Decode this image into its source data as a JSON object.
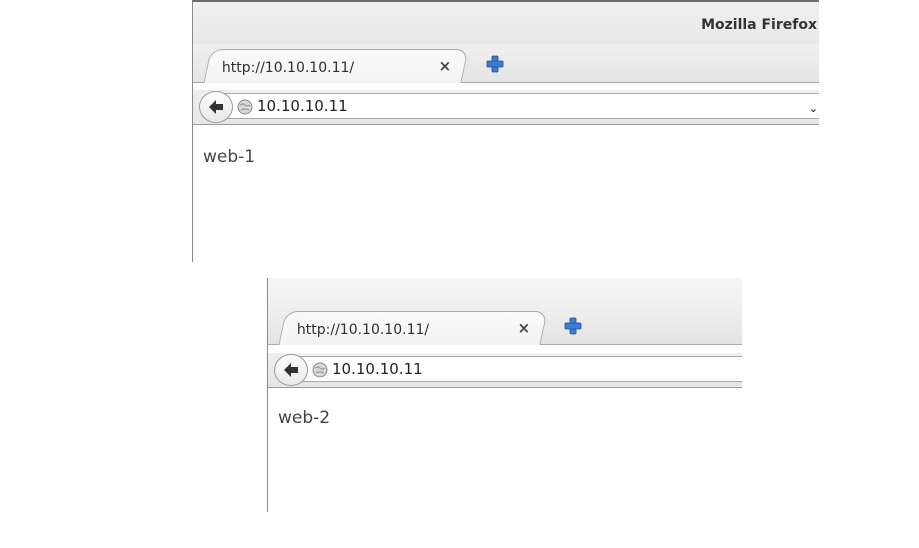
{
  "window": {
    "title": "Mozilla Firefox"
  },
  "screenshots": [
    {
      "tab": {
        "title": "http://10.10.10.11/",
        "close_glyph": "×"
      },
      "urlbar": {
        "value": "10.10.10.11",
        "dropdown_glyph": "⌄"
      },
      "page": {
        "text": "web-1"
      }
    },
    {
      "tab": {
        "title": "http://10.10.10.11/",
        "close_glyph": "×"
      },
      "urlbar": {
        "value": "10.10.10.11"
      },
      "page": {
        "text": "web-2"
      }
    }
  ],
  "colors": {
    "new_tab_plus": "#3c7bd6",
    "back_arrow": "#333333"
  },
  "icons": [
    "back-arrow-icon",
    "globe-icon",
    "new-tab-plus-icon",
    "close-icon",
    "dropdown-chevron-icon"
  ]
}
